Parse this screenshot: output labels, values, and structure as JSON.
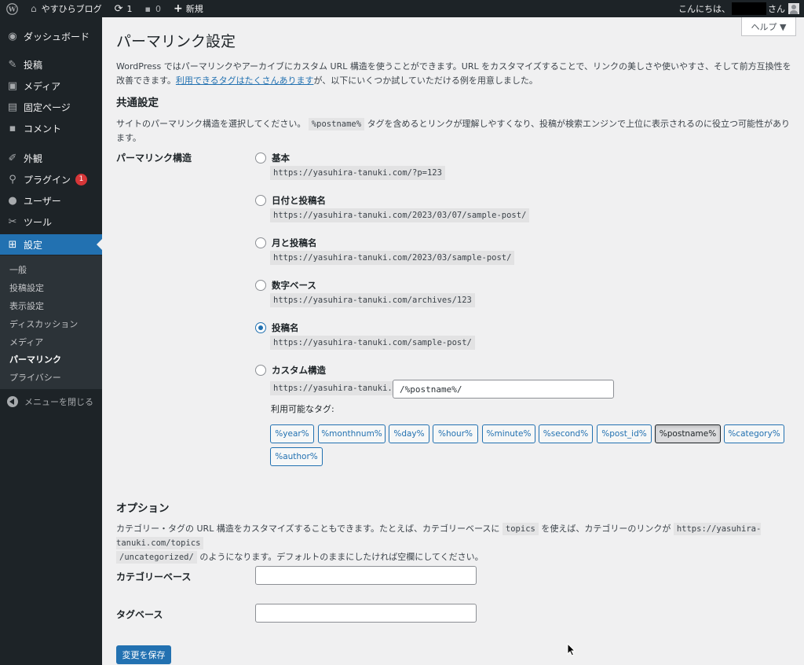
{
  "adminbar": {
    "site_name": "やすひらブログ",
    "updates_count": "1",
    "comments_count": "0",
    "new_label": "新規",
    "greeting_prefix": "こんにちは、",
    "greeting_suffix": "さん"
  },
  "sidebar": {
    "items": [
      {
        "label": "ダッシュボード",
        "icon": "dashboard-icon"
      },
      {
        "label": "投稿",
        "icon": "pin-icon"
      },
      {
        "label": "メディア",
        "icon": "media-icon"
      },
      {
        "label": "固定ページ",
        "icon": "page-icon"
      },
      {
        "label": "コメント",
        "icon": "comment-icon"
      },
      {
        "label": "外観",
        "icon": "appearance-icon"
      },
      {
        "label": "プラグイン",
        "icon": "plugin-icon",
        "badge": "1"
      },
      {
        "label": "ユーザー",
        "icon": "user-icon"
      },
      {
        "label": "ツール",
        "icon": "wrench-icon"
      },
      {
        "label": "設定",
        "icon": "settings-icon",
        "current": true
      }
    ],
    "submenu": [
      "一般",
      "投稿設定",
      "表示設定",
      "ディスカッション",
      "メディア",
      "パーマリンク",
      "プライバシー"
    ],
    "submenu_current": "パーマリンク",
    "collapse_label": "メニューを閉じる"
  },
  "help_label": "ヘルプ ▼",
  "page_title": "パーマリンク設定",
  "intro": {
    "line1": "WordPress ではパーマリンクやアーカイブにカスタム URL 構造を使うことができます。URL をカスタマイズすることで、リンクの美しさや使いやすさ、そして前方互換性を改善できます。",
    "link": "利用できるタグはたくさんあります",
    "line2_rest": "が、以下にいくつか試していただける例を用意しました。"
  },
  "common_heading": "共通設定",
  "common_desc": {
    "before": "サイトのパーマリンク構造を選択してください。",
    "code": "%postname%",
    "after": "タグを含めるとリンクが理解しやすくなり、投稿が検索エンジンで上位に表示されるのに役立つ可能性があります。"
  },
  "structure_label": "パーマリンク構造",
  "options": [
    {
      "label": "基本",
      "example": "https://yasuhira-tanuki.com/?p=123",
      "checked": false
    },
    {
      "label": "日付と投稿名",
      "example": "https://yasuhira-tanuki.com/2023/03/07/sample-post/",
      "checked": false
    },
    {
      "label": "月と投稿名",
      "example": "https://yasuhira-tanuki.com/2023/03/sample-post/",
      "checked": false
    },
    {
      "label": "数字ベース",
      "example": "https://yasuhira-tanuki.com/archives/123",
      "checked": false
    },
    {
      "label": "投稿名",
      "example": "https://yasuhira-tanuki.com/sample-post/",
      "checked": true
    },
    {
      "label": "カスタム構造",
      "checked": false
    }
  ],
  "custom": {
    "prefix": "https://yasuhira-tanuki.com",
    "value": "/%postname%/",
    "available_tags_label": "利用可能なタグ:"
  },
  "tags": [
    "%year%",
    "%monthnum%",
    "%day%",
    "%hour%",
    "%minute%",
    "%second%",
    "%post_id%",
    "%postname%",
    "%category%",
    "%author%"
  ],
  "tags_active": "%postname%",
  "options_heading": "オプション",
  "options_desc": {
    "before": "カテゴリー・タグの URL 構造をカスタマイズすることもできます。たとえば、カテゴリーベースに",
    "code1": "topics",
    "middle": "を使えば、カテゴリーのリンクが",
    "code2a": "https://yasuhira-tanuki.com/topics",
    "code2b": "/uncategorized/",
    "after": "のようになります。デフォルトのままにしたければ空欄にしてください。"
  },
  "category_base_label": "カテゴリーベース",
  "category_base_value": "",
  "tag_base_label": "タグベース",
  "tag_base_value": "",
  "save_label": "変更を保存"
}
